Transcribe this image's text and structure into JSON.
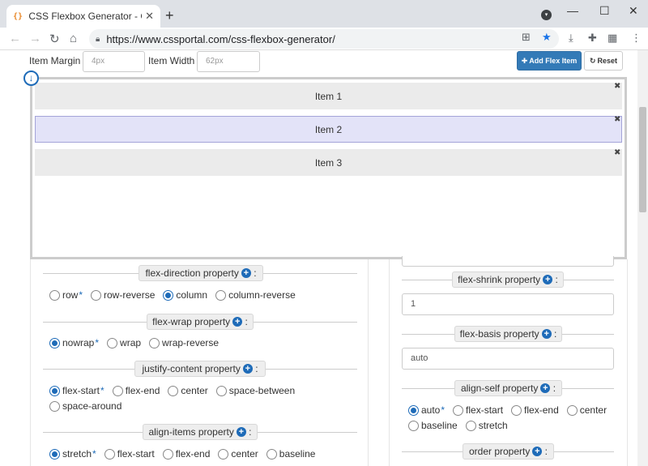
{
  "browser": {
    "tab_title": "CSS Flexbox Generator - CSS Po",
    "tab_favicon": "{}",
    "url": "https://www.cssportal.com/css-flexbox-generator/"
  },
  "controls": {
    "item_margin_label": "Item Margin",
    "item_margin_placeholder": "4px",
    "item_width_label": "Item Width",
    "item_width_placeholder": "62px",
    "add_button": "Add Flex Item",
    "reset_button": "Reset"
  },
  "flex_items": [
    {
      "label": "Item 1",
      "active": false
    },
    {
      "label": "Item 2",
      "active": true
    },
    {
      "label": "Item 3",
      "active": false
    }
  ],
  "left_properties": {
    "flex_direction": {
      "label": "flex-direction property",
      "options": [
        "row",
        "row-reverse",
        "column",
        "column-reverse"
      ],
      "selected": "column",
      "default": "row"
    },
    "flex_wrap": {
      "label": "flex-wrap property",
      "options": [
        "nowrap",
        "wrap",
        "wrap-reverse"
      ],
      "selected": "nowrap",
      "default": "nowrap"
    },
    "justify_content": {
      "label": "justify-content property",
      "options": [
        "flex-start",
        "flex-end",
        "center",
        "space-between",
        "space-around"
      ],
      "selected": "flex-start",
      "default": "flex-start"
    },
    "align_items": {
      "label": "align-items property",
      "options": [
        "stretch",
        "flex-start",
        "flex-end",
        "center",
        "baseline"
      ],
      "selected": "stretch",
      "default": "stretch"
    }
  },
  "right_properties": {
    "flex_shrink": {
      "label": "flex-shrink property",
      "value": "1"
    },
    "flex_basis": {
      "label": "flex-basis property",
      "value": "auto"
    },
    "align_self": {
      "label": "align-self property",
      "options": [
        "auto",
        "flex-start",
        "flex-end",
        "center",
        "baseline",
        "stretch"
      ],
      "selected": "auto",
      "default": "auto"
    },
    "order": {
      "label": "order property"
    }
  },
  "default_marker": "*",
  "colors": {
    "accent": "#1e6bb8",
    "primary_button": "#337ab7",
    "active_item": "#e3e3f8"
  }
}
